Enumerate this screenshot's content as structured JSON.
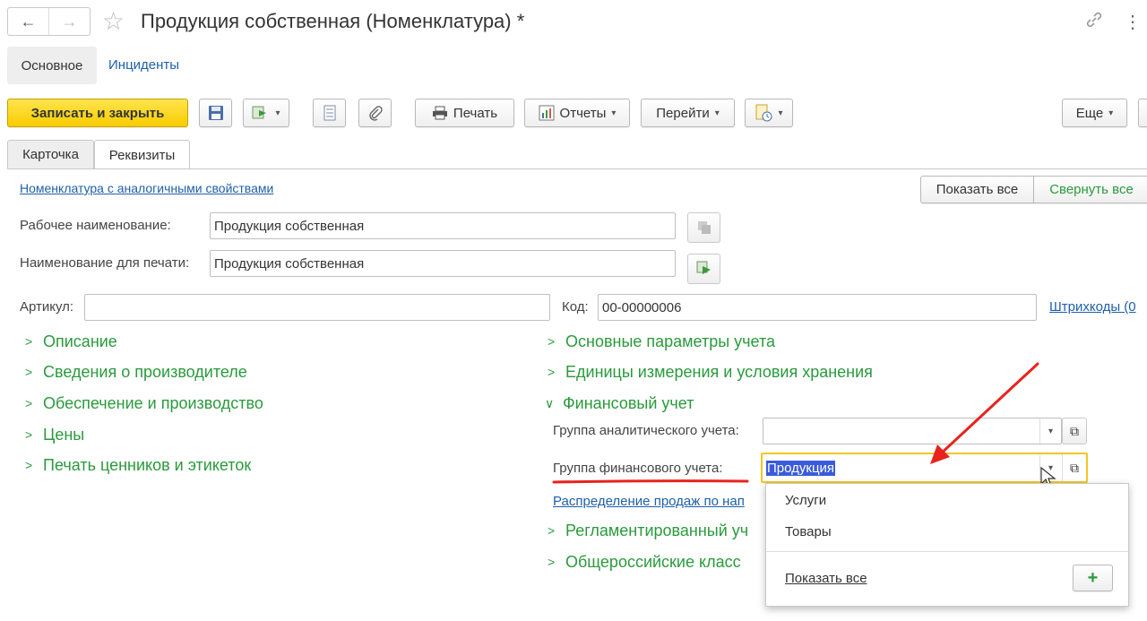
{
  "header": {
    "title": "Продукция собственная (Номенклатура) *",
    "back_icon": "←",
    "forward_icon": "→",
    "star_icon": "☆",
    "link_icon": "🔗",
    "more_icon": "⋮"
  },
  "section_tabs": {
    "main": "Основное",
    "incidents": "Инциденты"
  },
  "toolbar": {
    "save_close": "Записать и закрыть",
    "print": "Печать",
    "reports": "Отчеты",
    "goto": "Перейти",
    "more": "Еще",
    "caret": "▾"
  },
  "tabs": {
    "card": "Карточка",
    "requisites": "Реквизиты"
  },
  "form": {
    "similar_link": "Номенклатура с аналогичными свойствами",
    "show_all": "Показать все",
    "collapse_all": "Свернуть все",
    "work_name_label": "Рабочее наименование:",
    "work_name_value": "Продукция собственная",
    "print_name_label": "Наименование для печати:",
    "print_name_value": "Продукция собственная",
    "article_label": "Артикул:",
    "article_value": "",
    "code_label": "Код:",
    "code_value": "00-00000006",
    "barcodes_link": "Штрихкоды (0"
  },
  "groups_left": [
    {
      "label": "Описание",
      "chevron": ">"
    },
    {
      "label": "Сведения о производителе",
      "chevron": ">"
    },
    {
      "label": "Обеспечение и производство",
      "chevron": ">"
    },
    {
      "label": "Цены",
      "chevron": ">"
    },
    {
      "label": "Печать ценников и этикеток",
      "chevron": ">"
    }
  ],
  "groups_right": {
    "basic_params": "Основные параметры учета",
    "units": "Единицы измерения и условия хранения",
    "financial": "Финансовый учет",
    "regulated": "Регламентированный уч",
    "classifiers": "Общероссийские класс",
    "chevron_closed": ">",
    "chevron_open": "∨"
  },
  "financial": {
    "analytic_label": "Группа аналитического учета:",
    "analytic_value": "",
    "fin_label": "Группа финансового учета:",
    "fin_value": "Продукция",
    "sales_link": "Распределение продаж по нап",
    "open_icon": "⧉"
  },
  "dropdown": {
    "items": [
      "Услуги",
      "Товары"
    ],
    "show_all": "Показать все",
    "add": "+"
  },
  "colors": {
    "accent_green": "#2a9a3c",
    "link_blue": "#1f5fa8",
    "primary_yellow": "#f8cc00",
    "annotation_red": "#e8231e"
  }
}
